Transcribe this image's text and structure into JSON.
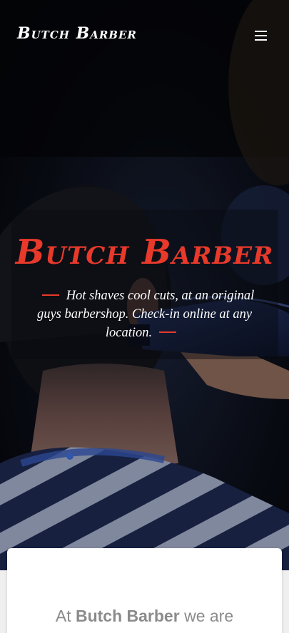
{
  "header": {
    "brand": "Butch Barber",
    "menu_icon": "hamburger-menu-icon"
  },
  "hero": {
    "title": "Butch Barber",
    "tagline": "Hot shaves cool cuts, at an original guys barbershop. Check-in online at any location.",
    "accent_color": "#e8392b"
  },
  "intro": {
    "prefix": "At",
    "brand": "Butch Barber",
    "suffix": "we are"
  },
  "colors": {
    "accent": "#e8392b",
    "background": "#efefef",
    "text_muted": "#8b8b8b"
  }
}
